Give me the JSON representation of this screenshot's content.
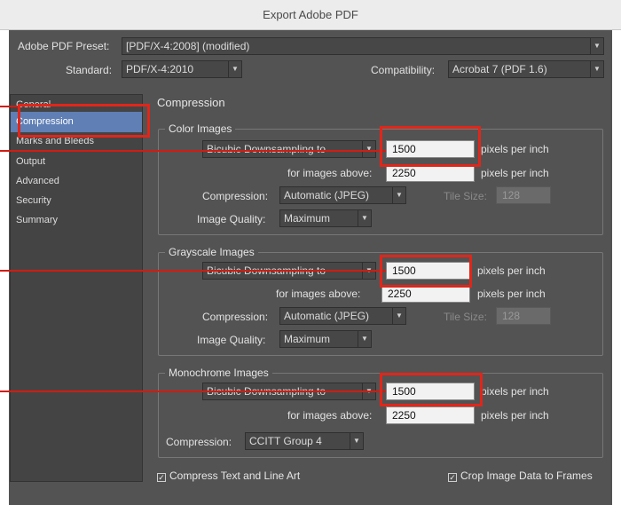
{
  "window": {
    "title": "Export Adobe PDF"
  },
  "header": {
    "preset_label": "Adobe PDF Preset:",
    "preset_value": "[PDF/X-4:2008] (modified)",
    "standard_label": "Standard:",
    "standard_value": "PDF/X-4:2010",
    "compat_label": "Compatibility:",
    "compat_value": "Acrobat 7 (PDF 1.6)"
  },
  "sidebar": {
    "items": [
      {
        "label": "General"
      },
      {
        "label": "Compression"
      },
      {
        "label": "Marks and Bleeds"
      },
      {
        "label": "Output"
      },
      {
        "label": "Advanced"
      },
      {
        "label": "Security"
      },
      {
        "label": "Summary"
      }
    ],
    "selected": "Compression"
  },
  "main": {
    "title": "Compression",
    "color": {
      "title": "Color Images",
      "sampling": "Bicubic Downsampling to",
      "ppi": "1500",
      "ppi_unit": "pixels per inch",
      "above_label": "for images above:",
      "above": "2250",
      "above_unit": "pixels per inch",
      "compression_label": "Compression:",
      "compression": "Automatic (JPEG)",
      "tile_label": "Tile Size:",
      "tile": "128",
      "quality_label": "Image Quality:",
      "quality": "Maximum"
    },
    "gray": {
      "title": "Grayscale Images",
      "sampling": "Bicubic Downsampling to",
      "ppi": "1500",
      "ppi_unit": "pixels per inch",
      "above_label": "for images above:",
      "above": "2250",
      "above_unit": "pixels per inch",
      "compression_label": "Compression:",
      "compression": "Automatic (JPEG)",
      "tile_label": "Tile Size:",
      "tile": "128",
      "quality_label": "Image Quality:",
      "quality": "Maximum"
    },
    "mono": {
      "title": "Monochrome Images",
      "sampling": "Bicubic Downsampling to",
      "ppi": "1500",
      "ppi_unit": "pixels per inch",
      "above_label": "for images above:",
      "above": "2250",
      "above_unit": "pixels per inch",
      "compression_label": "Compression:",
      "compression": "CCITT Group 4"
    },
    "compress_text": "Compress Text and Line Art",
    "crop_image": "Crop Image Data to Frames"
  },
  "colors": {
    "highlight": "#e0261a",
    "selection": "#5f7fb5",
    "panel": "#535353"
  }
}
